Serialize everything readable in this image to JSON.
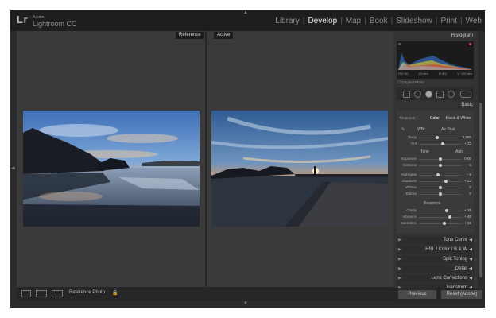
{
  "app": {
    "logo": "Lr",
    "brand_small": "Adobe",
    "brand_name": "Lightroom CC"
  },
  "modules": [
    "Library",
    "Develop",
    "Map",
    "Book",
    "Slideshow",
    "Print",
    "Web"
  ],
  "active_module": "Develop",
  "view": {
    "reference_label": "Reference",
    "active_label": "Active"
  },
  "toolbar": {
    "reference_photo_label": "Reference Photo :"
  },
  "panels": {
    "histogram": {
      "title": "Histogram",
      "info": [
        "ISO 50",
        "24 mm",
        "f / 8.0",
        "1 ⁄ 125 sec"
      ],
      "original_photo": "Original Photo"
    },
    "basic": {
      "title": "Basic",
      "treatment_label": "Treatment :",
      "treatment_options": [
        "Color",
        "Black & White"
      ],
      "wb_label": "WB :",
      "wb_value": "As Shot",
      "tone_label": "Tone",
      "tone_auto": "Auto",
      "presence_label": "Presence",
      "sliders": {
        "temp": {
          "label": "Temp",
          "value": "5,650",
          "level": 0.42
        },
        "tint": {
          "label": "Tint",
          "value": "+ 13",
          "level": 0.55
        },
        "exposure": {
          "label": "Exposure",
          "value": "0.00",
          "level": 0.5
        },
        "contrast": {
          "label": "Contrast",
          "value": "0",
          "level": 0.5
        },
        "highlights": {
          "label": "Highlights",
          "value": "– 9",
          "level": 0.45
        },
        "shadows": {
          "label": "Shadows",
          "value": "+ 27",
          "level": 0.63
        },
        "whites": {
          "label": "Whites",
          "value": "0",
          "level": 0.5
        },
        "blacks": {
          "label": "Blacks",
          "value": "0",
          "level": 0.5
        },
        "clarity": {
          "label": "Clarity",
          "value": "+ 31",
          "level": 0.65
        },
        "vibrance": {
          "label": "Vibrance",
          "value": "+ 45",
          "level": 0.72
        },
        "saturation": {
          "label": "Saturation",
          "value": "+ 18",
          "level": 0.59
        }
      }
    },
    "collapsed": [
      {
        "label": "Tone Curve"
      },
      {
        "label": "HSL / Color / B & W"
      },
      {
        "label": "Split Toning"
      },
      {
        "label": "Detail"
      },
      {
        "label": "Lens Corrections"
      },
      {
        "label": "Transform"
      }
    ]
  },
  "buttons": {
    "previous": "Previous",
    "reset": "Reset (Adobe)"
  }
}
